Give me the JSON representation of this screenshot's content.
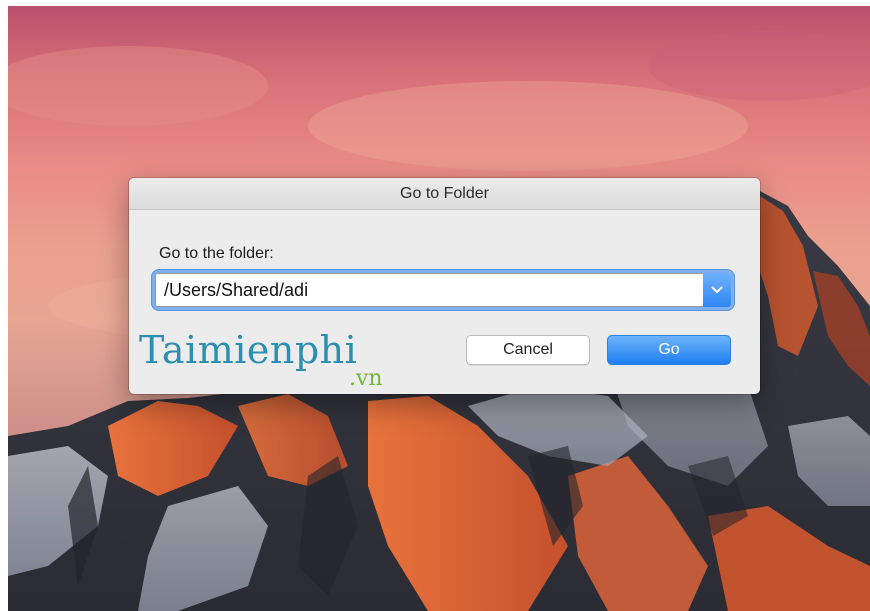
{
  "dialog": {
    "title": "Go to Folder",
    "prompt": "Go to the folder:",
    "path_value": "/Users/Shared/adi",
    "cancel_label": "Cancel",
    "go_label": "Go"
  },
  "watermark": {
    "name": "Taimienphi",
    "tld": ".vn"
  },
  "icons": {
    "combo_arrow": "chevron-down-icon"
  },
  "colors": {
    "accent": "#2f86f5",
    "focus_ring": "#7fb0ee",
    "watermark_blue": "#2a8fb0",
    "watermark_green": "#74b43a"
  }
}
